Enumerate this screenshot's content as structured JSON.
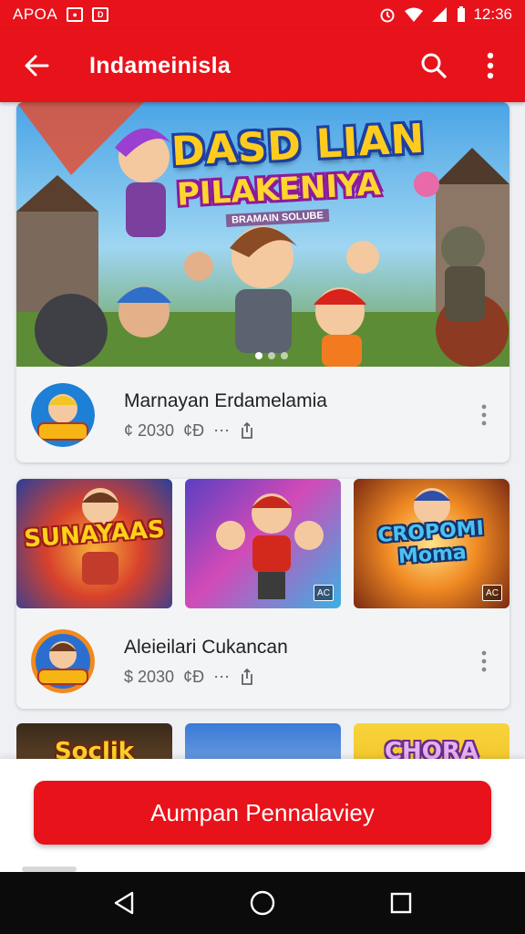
{
  "status_bar": {
    "carrier": "APOA",
    "time": "12:36"
  },
  "app_bar": {
    "title": "Indameinisla"
  },
  "featured": {
    "hero_title": "DASD LIAN",
    "hero_subtitle": "PILAKENIYA",
    "hero_tagline": "BRAMAIN SOLUBE",
    "item_title": "Marnayan Erdamelamia",
    "item_price": "¢ 2030",
    "meta_glyph": "¢Ð"
  },
  "collection": {
    "thumbs": [
      {
        "label": "SUNAYAAS",
        "badge": ""
      },
      {
        "label": "",
        "badge": "AC"
      },
      {
        "label": "CROPOMI Moma",
        "badge": "AC"
      }
    ],
    "item_title": "Aleieilari Cukancan",
    "item_price": "$ 2030",
    "meta_glyph": "¢Ð"
  },
  "peek": [
    "Soclik",
    "",
    "CHORA"
  ],
  "cta": {
    "label": "Aumpan Pennalaviey"
  },
  "icons": {
    "back": "arrow-left",
    "search": "search",
    "more": "more-vertical",
    "nav_back": "triangle-back",
    "nav_home": "circle-home",
    "nav_recents": "square-recents"
  },
  "colors": {
    "brand_red": "#e8121b",
    "nav_bar": "#0b0b0b"
  }
}
